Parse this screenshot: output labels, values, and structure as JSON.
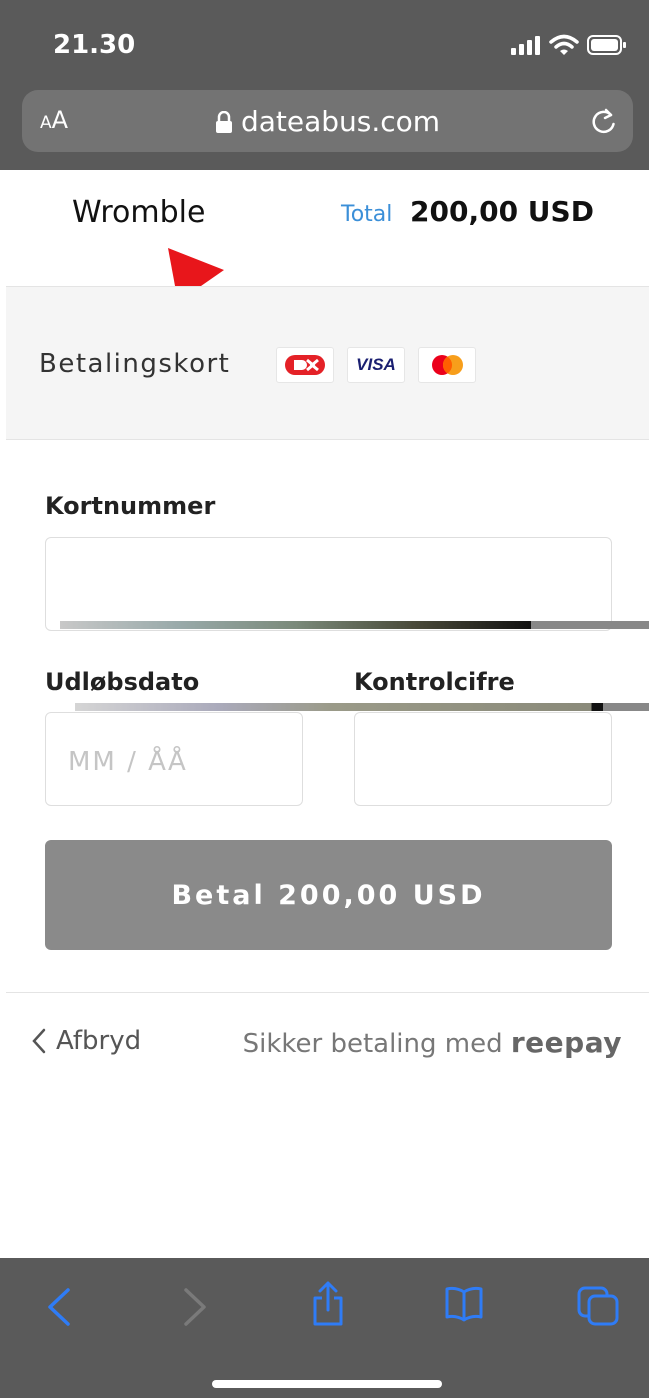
{
  "status_bar": {
    "time": "21.30"
  },
  "browser": {
    "text_size_small": "A",
    "text_size_large": "A",
    "url": "dateabus.com"
  },
  "header": {
    "merchant_name": "Wromble",
    "total_label": "Total",
    "total_value": "200,00 USD"
  },
  "payment_method": {
    "label": "Betalingskort",
    "visa_text": "VISA",
    "cards": [
      "dankort-icon",
      "visa-icon",
      "mastercard-icon"
    ]
  },
  "form": {
    "card_number_label": "Kortnummer",
    "expiry_label": "Udløbsdato",
    "expiry_placeholder": "MM / ÅÅ",
    "cvc_label": "Kontrolcifre",
    "pay_button": "Betal 200,00 USD"
  },
  "footer": {
    "cancel_label": "Afbryd",
    "secure_text": "Sikker betaling med",
    "brand": "reepay"
  },
  "colors": {
    "accent_blue": "#3b8fd8",
    "button_gray": "#8a8a8a",
    "arrow_red": "#e8161b",
    "ios_blue": "#2f7cf6"
  }
}
